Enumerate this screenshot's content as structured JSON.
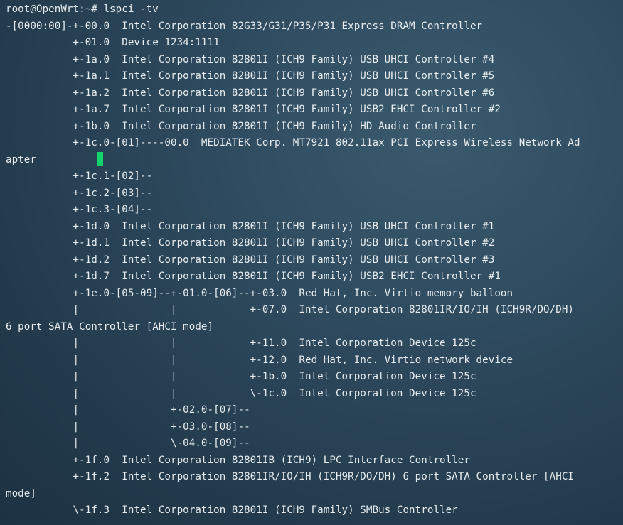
{
  "terminal": {
    "cursor_color": "#12d46a",
    "lines": [
      "root@OpenWrt:~# lspci -tv",
      "-[0000:00]-+-00.0  Intel Corporation 82G33/G31/P35/P31 Express DRAM Controller",
      "           +-01.0  Device 1234:1111",
      "           +-1a.0  Intel Corporation 82801I (ICH9 Family) USB UHCI Controller #4",
      "           +-1a.1  Intel Corporation 82801I (ICH9 Family) USB UHCI Controller #5",
      "           +-1a.2  Intel Corporation 82801I (ICH9 Family) USB UHCI Controller #6",
      "           +-1a.7  Intel Corporation 82801I (ICH9 Family) USB2 EHCI Controller #2",
      "           +-1b.0  Intel Corporation 82801I (ICH9 Family) HD Audio Controller",
      "           +-1c.0-[01]----00.0  MEDIATEK Corp. MT7921 802.11ax PCI Express Wireless Network Ad",
      "apter",
      "           +-1c.1-[02]--",
      "           +-1c.2-[03]--",
      "           +-1c.3-[04]--",
      "           +-1d.0  Intel Corporation 82801I (ICH9 Family) USB UHCI Controller #1",
      "           +-1d.1  Intel Corporation 82801I (ICH9 Family) USB UHCI Controller #2",
      "           +-1d.2  Intel Corporation 82801I (ICH9 Family) USB UHCI Controller #3",
      "           +-1d.7  Intel Corporation 82801I (ICH9 Family) USB2 EHCI Controller #1",
      "           +-1e.0-[05-09]--+-01.0-[06]--+-03.0  Red Hat, Inc. Virtio memory balloon",
      "           |               |            +-07.0  Intel Corporation 82801IR/IO/IH (ICH9R/DO/DH)",
      "6 port SATA Controller [AHCI mode]",
      "           |               |            +-11.0  Intel Corporation Device 125c",
      "           |               |            +-12.0  Red Hat, Inc. Virtio network device",
      "           |               |            +-1b.0  Intel Corporation Device 125c",
      "           |               |            \\-1c.0  Intel Corporation Device 125c",
      "           |               +-02.0-[07]--",
      "           |               +-03.0-[08]--",
      "           |               \\-04.0-[09]--",
      "           +-1f.0  Intel Corporation 82801IB (ICH9) LPC Interface Controller",
      "           +-1f.2  Intel Corporation 82801IR/IO/IH (ICH9R/DO/DH) 6 port SATA Controller [AHCI",
      "mode]",
      "           \\-1f.3  Intel Corporation 82801I (ICH9 Family) SMBus Controller"
    ]
  }
}
